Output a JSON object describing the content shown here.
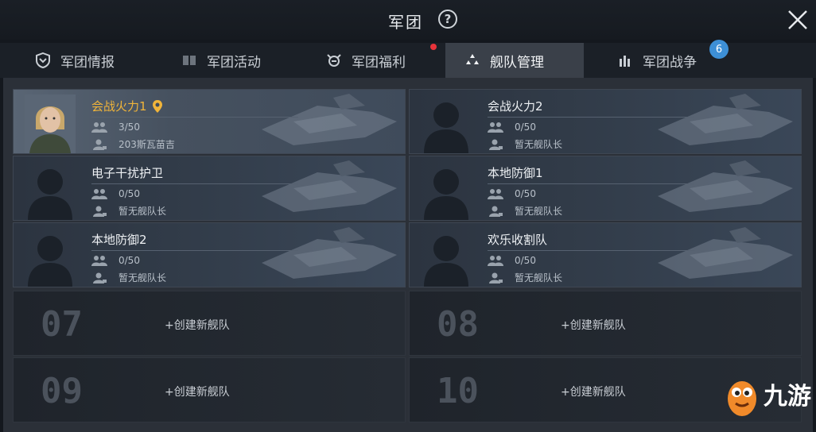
{
  "header": {
    "title": "军团",
    "help_icon": "question-icon",
    "close_icon": "close-icon"
  },
  "tabs": [
    {
      "label": "军团情报",
      "icon": "shield-icon"
    },
    {
      "label": "军团活动",
      "icon": "book-icon"
    },
    {
      "label": "军团福利",
      "icon": "gift-icon",
      "notification_dot": true
    },
    {
      "label": "舰队管理",
      "icon": "fleet-icon",
      "active": true
    },
    {
      "label": "军团战争",
      "icon": "battle-icon",
      "badge": "6"
    }
  ],
  "fleets": [
    {
      "name": "会战火力1",
      "members": "3/50",
      "leader": "203斯瓦苗吉",
      "location_marker": true
    },
    {
      "name": "会战火力2",
      "members": "0/50",
      "leader": "暂无舰队长"
    },
    {
      "name": "电子干扰护卫",
      "members": "0/50",
      "leader": "暂无舰队长"
    },
    {
      "name": "本地防御1",
      "members": "0/50",
      "leader": "暂无舰队长"
    },
    {
      "name": "本地防御2",
      "members": "0/50",
      "leader": "暂无舰队长"
    },
    {
      "name": "欢乐收割队",
      "members": "0/50",
      "leader": "暂无舰队长"
    }
  ],
  "empty_slots": [
    {
      "number": "07",
      "label": "+创建新舰队"
    },
    {
      "number": "08",
      "label": "+创建新舰队"
    },
    {
      "number": "09",
      "label": "+创建新舰队"
    },
    {
      "number": "10",
      "label": "+创建新舰队"
    }
  ],
  "watermark": {
    "text": "九游"
  },
  "colors": {
    "accent_gold": "#f0b43a",
    "badge_blue": "#3d8fd6",
    "dot_red": "#e8333a"
  }
}
